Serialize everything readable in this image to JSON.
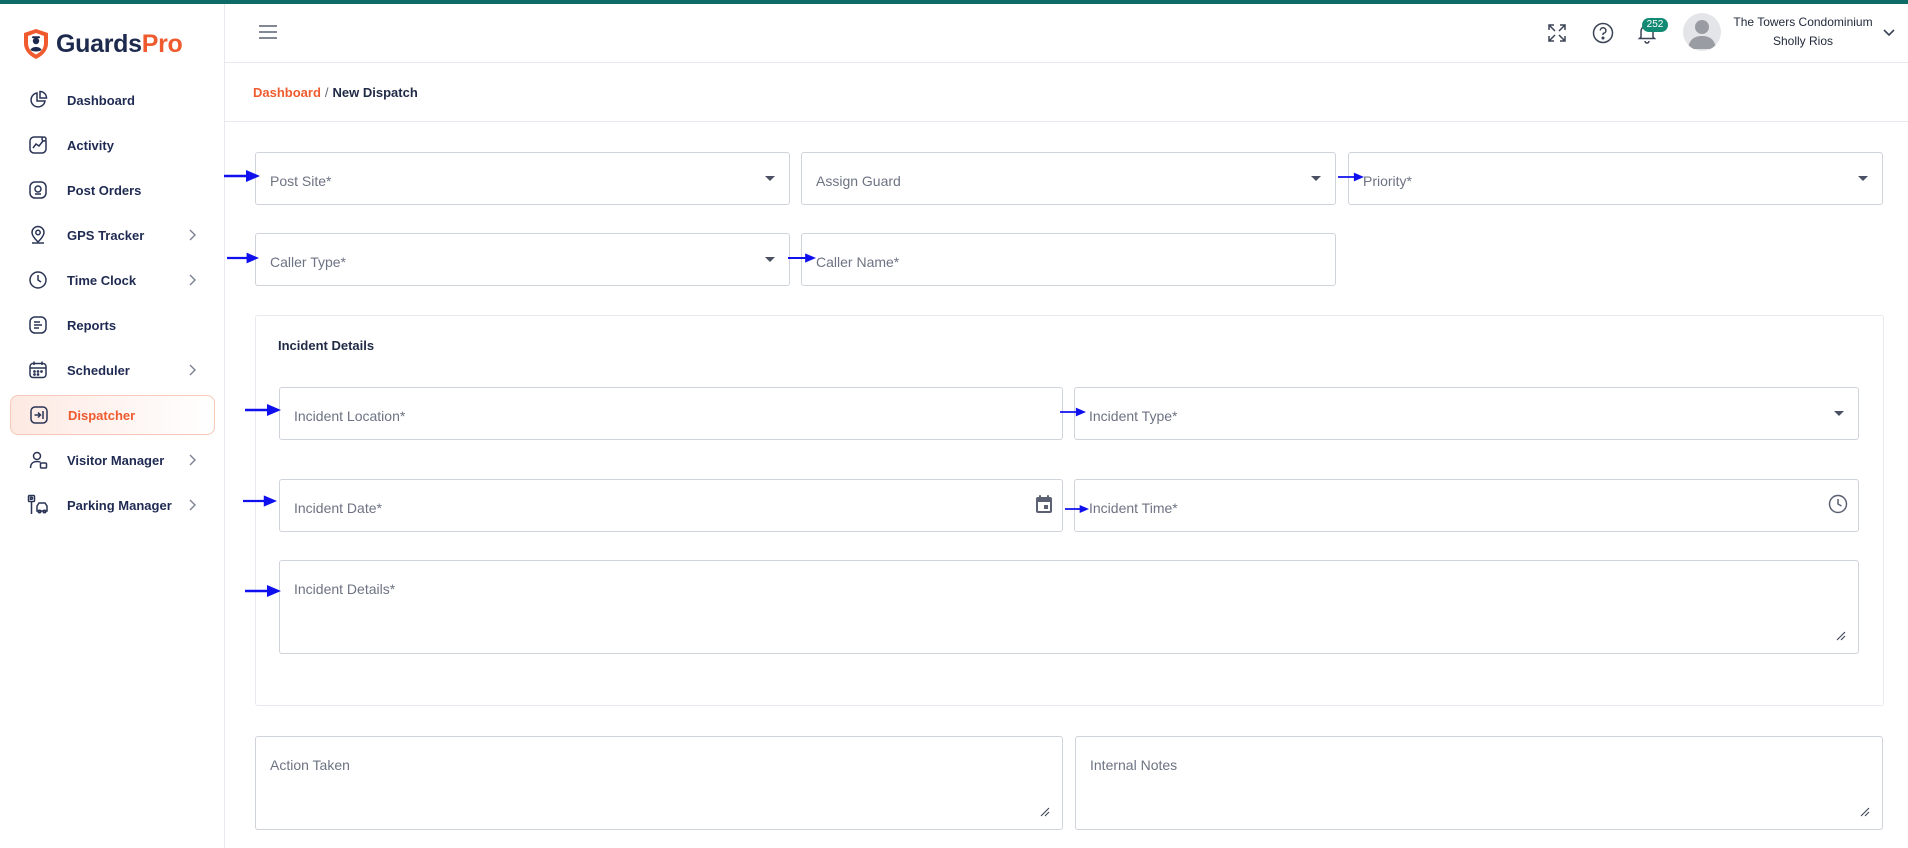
{
  "app": {
    "brand_part1": "Guards",
    "brand_part2": "Pro",
    "accent_color": "#ef5b2f",
    "brand_dark": "#1d2a4d",
    "top_bar_color": "#0f6b66"
  },
  "sidebar": {
    "items": [
      {
        "label": "Dashboard",
        "icon": "dashboard-pie-icon",
        "has_submenu": false,
        "active": false
      },
      {
        "label": "Activity",
        "icon": "activity-chart-icon",
        "has_submenu": false,
        "active": false
      },
      {
        "label": "Post Orders",
        "icon": "post-orders-icon",
        "has_submenu": false,
        "active": false
      },
      {
        "label": "GPS Tracker",
        "icon": "gps-pin-icon",
        "has_submenu": true,
        "active": false
      },
      {
        "label": "Time Clock",
        "icon": "clock-icon",
        "has_submenu": true,
        "active": false
      },
      {
        "label": "Reports",
        "icon": "reports-icon",
        "has_submenu": false,
        "active": false
      },
      {
        "label": "Scheduler",
        "icon": "calendar-icon",
        "has_submenu": true,
        "active": false
      },
      {
        "label": "Dispatcher",
        "icon": "dispatcher-icon",
        "has_submenu": false,
        "active": true
      },
      {
        "label": "Visitor Manager",
        "icon": "visitor-icon",
        "has_submenu": true,
        "active": false
      },
      {
        "label": "Parking Manager",
        "icon": "parking-icon",
        "has_submenu": true,
        "active": false
      }
    ]
  },
  "header": {
    "notification_count": "252",
    "organization": "The Towers Condominium",
    "user_name": "Sholly Rios"
  },
  "breadcrumb": {
    "home": "Dashboard",
    "separator": "/",
    "current": "New Dispatch"
  },
  "form": {
    "post_site": "Post Site*",
    "assign_guard": "Assign Guard",
    "priority": "Priority*",
    "caller_type": "Caller Type*",
    "caller_name": "Caller Name*",
    "incident_section_title": "Incident Details",
    "incident_location": "Incident Location*",
    "incident_type": "Incident Type*",
    "incident_date": "Incident Date*",
    "incident_time": "Incident Time*",
    "incident_details": "Incident Details*",
    "action_taken": "Action Taken",
    "internal_notes": "Internal Notes"
  },
  "annotation_arrow_color": "#1010ee"
}
